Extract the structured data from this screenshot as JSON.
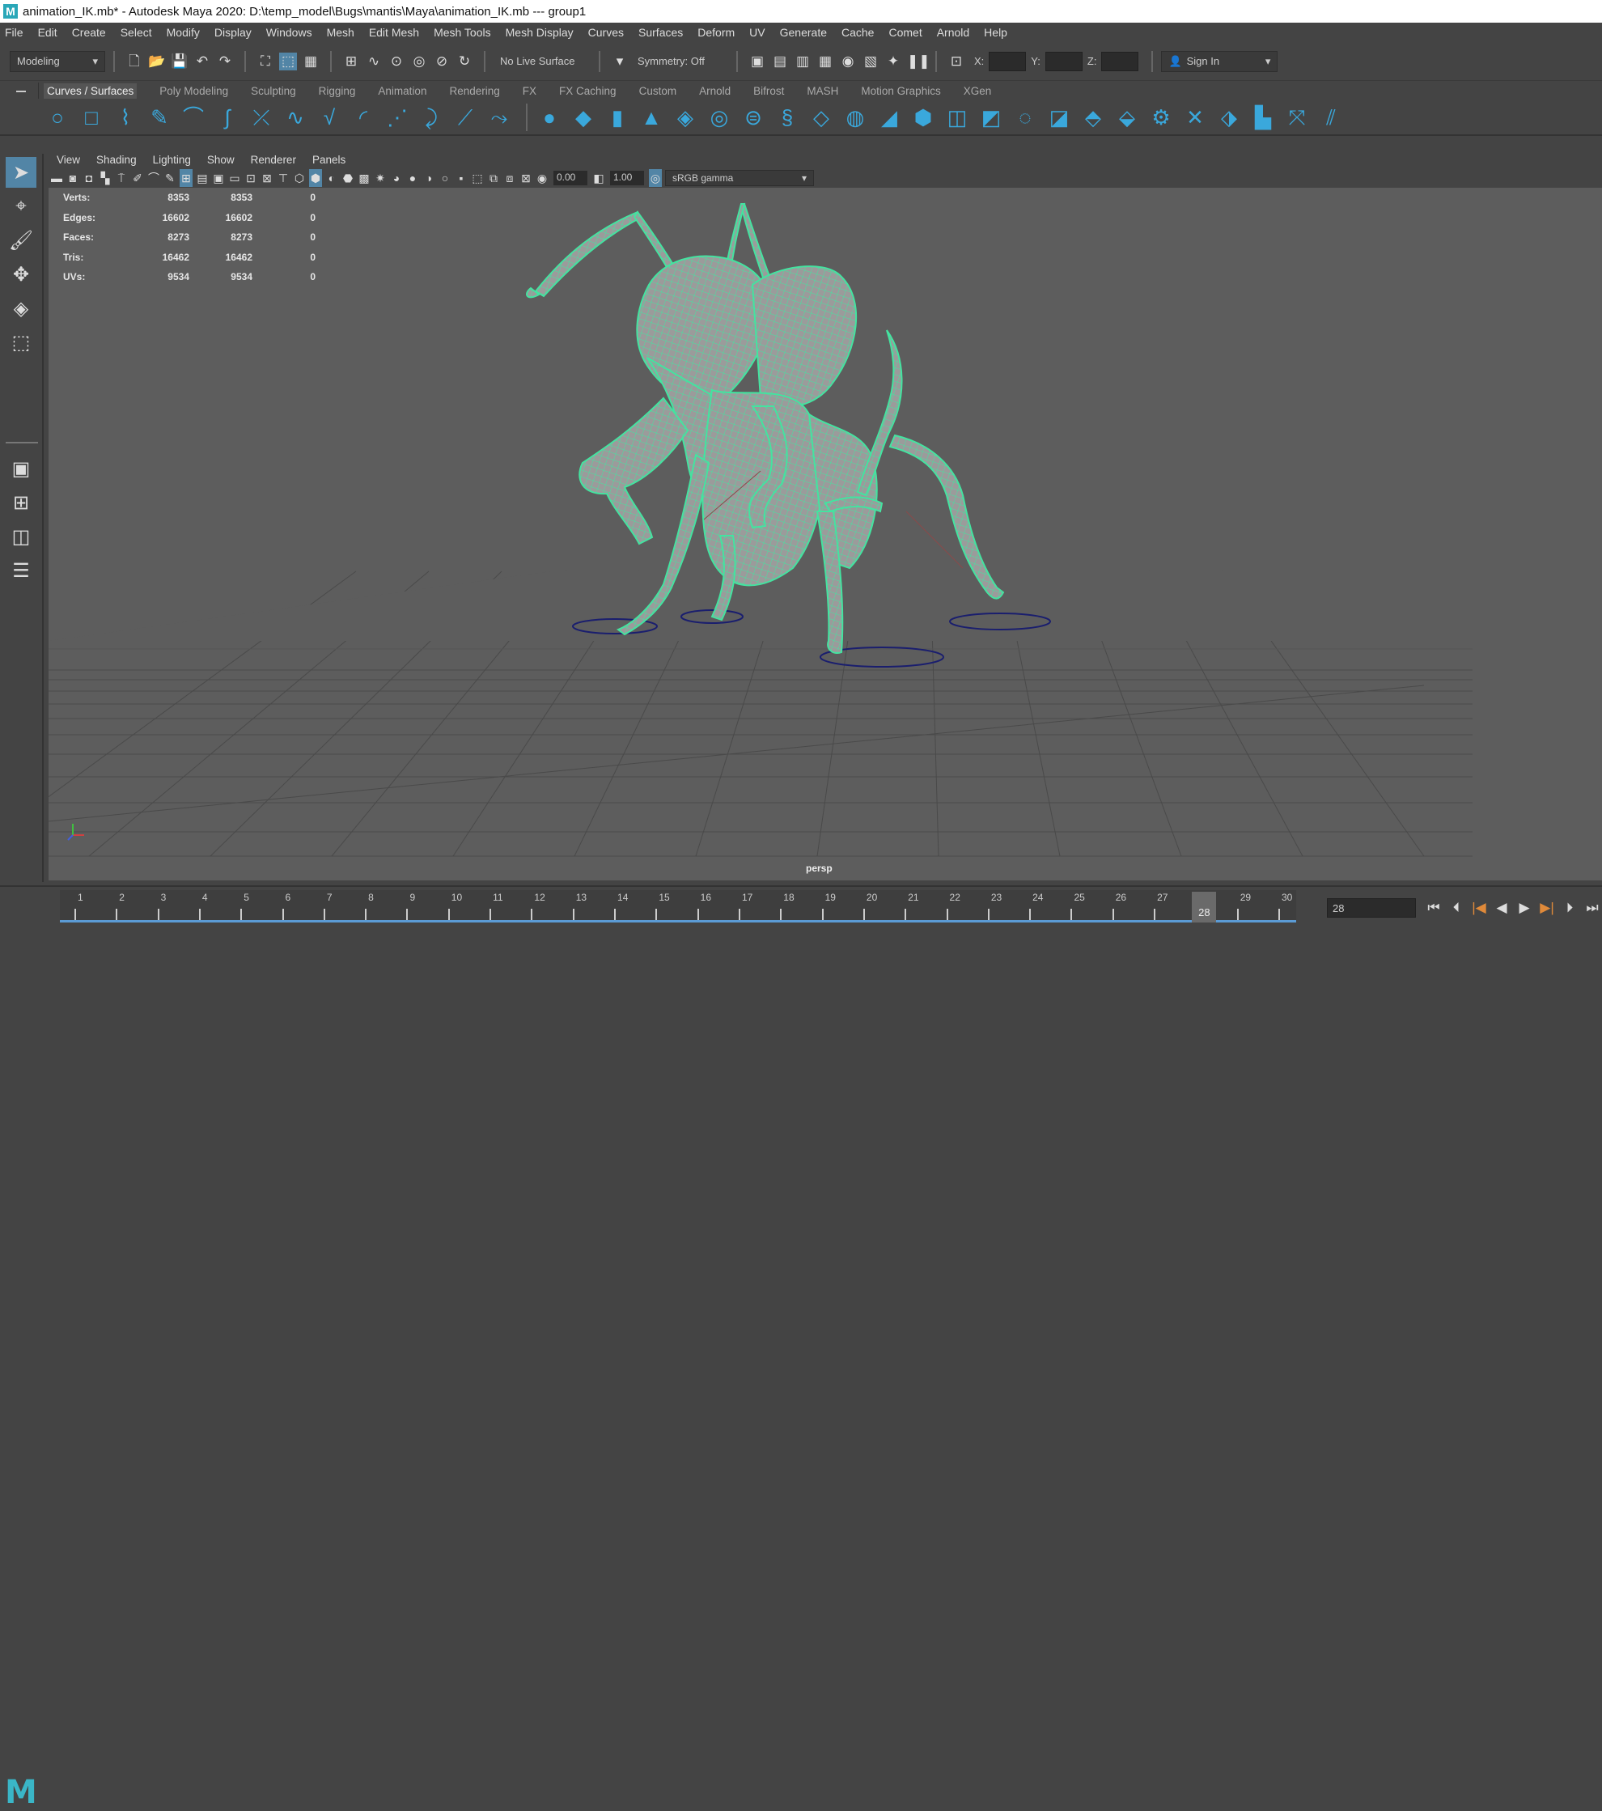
{
  "window": {
    "title": "animation_IK.mb* - Autodesk Maya 2020: D:\\temp_model\\Bugs\\mantis\\Maya\\animation_IK.mb   ---   group1"
  },
  "menubar": {
    "items": [
      "File",
      "Edit",
      "Create",
      "Select",
      "Modify",
      "Display",
      "Windows",
      "Mesh",
      "Edit Mesh",
      "Mesh Tools",
      "Mesh Display",
      "Curves",
      "Surfaces",
      "Deform",
      "UV",
      "Generate",
      "Cache",
      "Comet",
      "Arnold",
      "Help"
    ]
  },
  "statusline": {
    "menuset": "Modeling",
    "live_surface": "No Live Surface",
    "symmetry": "Symmetry: Off",
    "x_label": "X:",
    "y_label": "Y:",
    "z_label": "Z:",
    "sign_in": "Sign In"
  },
  "shelf": {
    "tabs": [
      "Curves / Surfaces",
      "Poly Modeling",
      "Sculpting",
      "Rigging",
      "Animation",
      "Rendering",
      "FX",
      "FX Caching",
      "Custom",
      "Arnold",
      "Bifrost",
      "MASH",
      "Motion Graphics",
      "XGen"
    ],
    "active": "Curves / Surfaces"
  },
  "panel": {
    "menus": [
      "View",
      "Shading",
      "Lighting",
      "Show",
      "Renderer",
      "Panels"
    ],
    "exposure": "0.00",
    "gamma": "1.00",
    "colorspace": "sRGB gamma",
    "camera": "persp"
  },
  "hud": {
    "rows": [
      {
        "label": "Verts:",
        "a": "8353",
        "b": "8353",
        "c": "0"
      },
      {
        "label": "Edges:",
        "a": "16602",
        "b": "16602",
        "c": "0"
      },
      {
        "label": "Faces:",
        "a": "8273",
        "b": "8273",
        "c": "0"
      },
      {
        "label": "Tris:",
        "a": "16462",
        "b": "16462",
        "c": "0"
      },
      {
        "label": "UVs:",
        "a": "9534",
        "b": "9534",
        "c": "0"
      }
    ]
  },
  "timeline": {
    "labels": [
      "1",
      "2",
      "3",
      "4",
      "5",
      "6",
      "7",
      "8",
      "9",
      "10",
      "11",
      "12",
      "13",
      "14",
      "15",
      "16",
      "17",
      "18",
      "19",
      "20",
      "21",
      "22",
      "23",
      "24",
      "25",
      "26",
      "27",
      "28",
      "29",
      "30"
    ],
    "current_frame": "28",
    "frame_field": "28"
  },
  "colors": {
    "wire": "#44e3a0",
    "accent": "#5285a6",
    "viewport_bg": "#5d5d5d",
    "shelf_icon": "#3aa8dc"
  }
}
